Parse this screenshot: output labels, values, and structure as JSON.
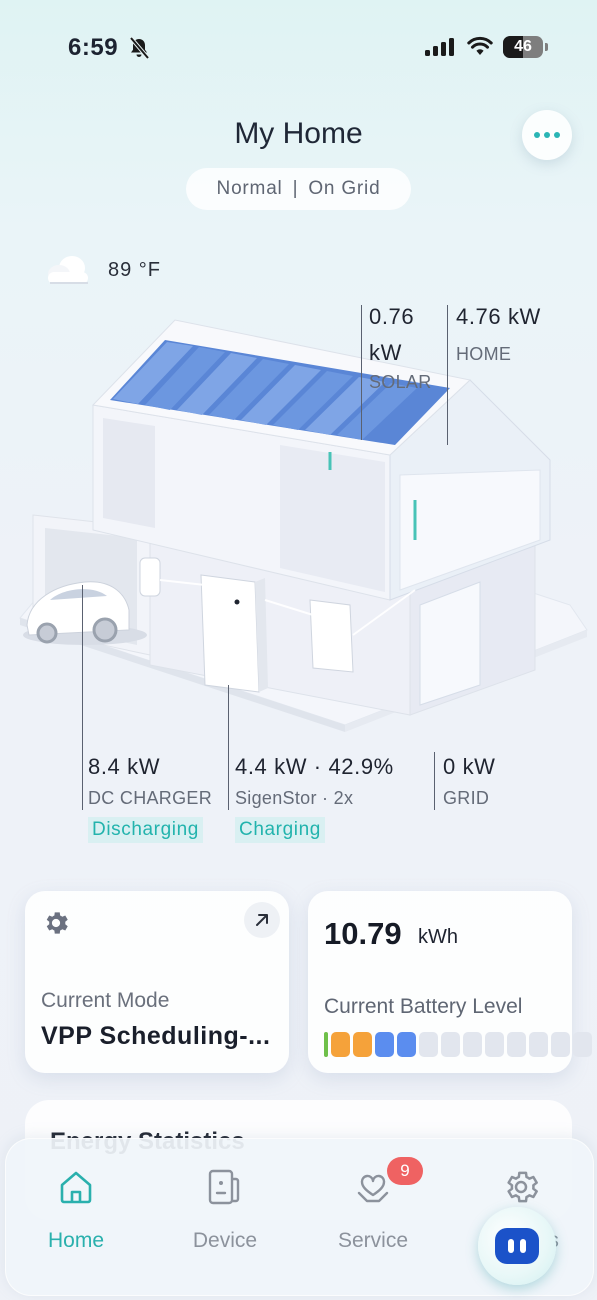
{
  "status_bar": {
    "time": "6:59",
    "battery_level": "46"
  },
  "header": {
    "title": "My Home",
    "mode": "Normal",
    "grid_state": "On Grid"
  },
  "weather": {
    "temperature": "89 °F"
  },
  "metrics": {
    "solar": {
      "value": "0.76",
      "unit": "kW",
      "label": "SOLAR"
    },
    "home": {
      "value": "4.76",
      "unit": "kW",
      "label": "HOME"
    },
    "dc_charger": {
      "value": "8.4",
      "unit": "kW",
      "label": "DC CHARGER",
      "state": "Discharging"
    },
    "storage": {
      "value": "4.4",
      "unit": "kW",
      "percent": "42.9%",
      "label": "SigenStor",
      "count": "2x",
      "state": "Charging"
    },
    "grid": {
      "value": "0",
      "unit": "kW",
      "label": "GRID"
    }
  },
  "mode_card": {
    "label": "Current Mode",
    "value": "VPP Scheduling-..."
  },
  "battery_card": {
    "value": "10.79",
    "unit": "kWh",
    "label": "Current Battery Level",
    "segments": [
      "#6fc04a",
      "#f5a23a",
      "#f5a23a",
      "#5b8def",
      "#5b8def"
    ],
    "empty_segments": 8
  },
  "stats": {
    "title": "Energy Statistics"
  },
  "nav": {
    "items": [
      {
        "label": "Home"
      },
      {
        "label": "Device"
      },
      {
        "label": "Service",
        "badge": "9"
      },
      {
        "label": "Settings"
      }
    ]
  },
  "colors": {
    "accent": "#2ab0ad",
    "badge": "#ef6262",
    "inactive": "#8c929c"
  }
}
